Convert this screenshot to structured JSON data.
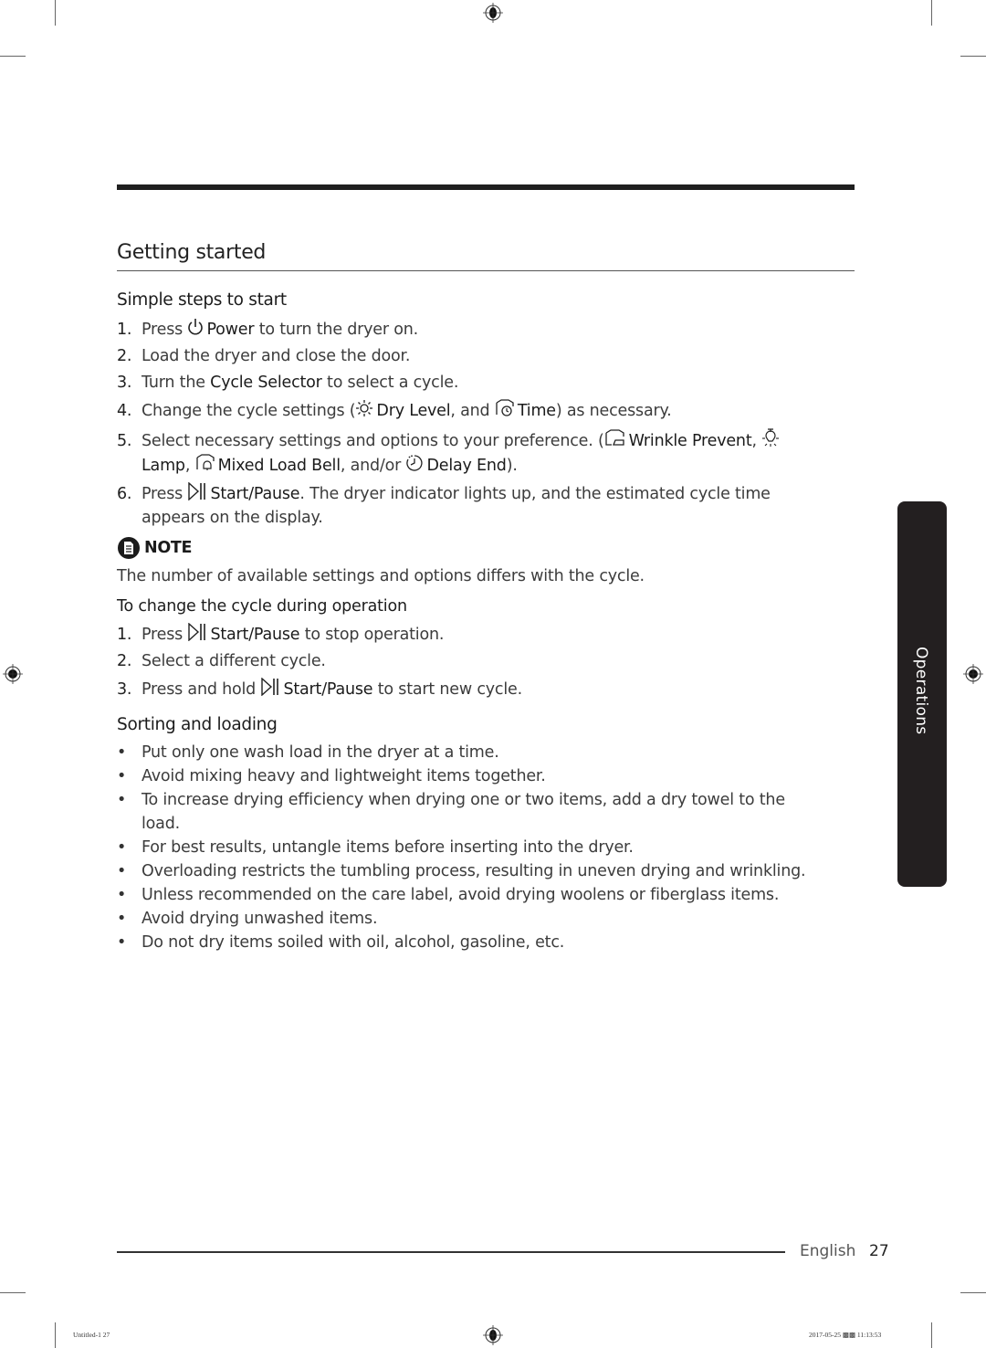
{
  "section_title": "Getting started",
  "simple_steps": {
    "heading": "Simple steps to start",
    "steps": [
      {
        "num": "1.",
        "pre": "Press",
        "icon": "power-icon",
        "bold": "Power",
        "post": "to turn the dryer on."
      },
      {
        "num": "2.",
        "text": "Load the dryer and close the door."
      },
      {
        "num": "3.",
        "pre": "Turn the",
        "bold": "Cycle Selector",
        "post": "to select a cycle."
      },
      {
        "num": "4.",
        "pre": "Change the cycle settings (",
        "icon1": "sun-icon",
        "bold1": "Dry Level",
        "mid": ", and",
        "icon2": "shirt-timer-icon",
        "bold2": "Time",
        "post": ") as necessary."
      },
      {
        "num": "5.",
        "line1_pre": "Select necessary settings and options to your preference. (",
        "icon1": "shirt-iron-icon",
        "bold1": "Wrinkle Prevent",
        "sep1": ",",
        "icon2": "lamp-icon",
        "bold2": "Lamp",
        "sep2": ",",
        "icon3": "shirt-bell-icon",
        "bold3": "Mixed Load Bell",
        "mid": ", and/or",
        "icon4": "delay-clock-icon",
        "bold4": "Delay End",
        "post": ")."
      },
      {
        "num": "6.",
        "pre": "Press",
        "icon": "start-pause-icon",
        "bold": "Start/Pause",
        "post": ". The dryer indicator lights up, and the estimated cycle time",
        "line2": "appears on the display."
      }
    ]
  },
  "note": {
    "label": "NOTE",
    "icon": "note-icon",
    "text": "The number of available settings and options differs with the cycle."
  },
  "change_cycle": {
    "heading": "To change the cycle during operation",
    "steps": [
      {
        "num": "1.",
        "pre": "Press",
        "icon": "start-pause-icon",
        "bold": "Start/Pause",
        "post": "to stop operation."
      },
      {
        "num": "2.",
        "text": "Select a different cycle."
      },
      {
        "num": "3.",
        "pre": "Press and hold",
        "icon": "start-pause-icon",
        "bold": "Start/Pause",
        "post": "to start new cycle."
      }
    ]
  },
  "sorting": {
    "heading": "Sorting and loading",
    "bullets": [
      "Put only one wash load in the dryer at a time.",
      "Avoid mixing heavy and lightweight items together.",
      "To increase drying efficiency when drying one or two items, add a dry towel to the",
      "load.",
      "For best results, untangle items before inserting into the dryer.",
      "Overloading restricts the tumbling process, resulting in uneven drying and wrinkling.",
      "Unless recommended on the care label, avoid drying woolens or fiberglass items.",
      "Avoid drying unwashed items.",
      "Do not dry items soiled with oil, alcohol, gasoline, etc."
    ]
  },
  "side_tab": "Operations",
  "footer": {
    "language": "English",
    "page_number": "27"
  },
  "slug": {
    "left": "Untitled-1   27",
    "right": "2017-05-25   ▩▩ 11:13:53"
  },
  "colors": {
    "tab_bg": "#231f20",
    "rule": "#1f1f1f"
  }
}
